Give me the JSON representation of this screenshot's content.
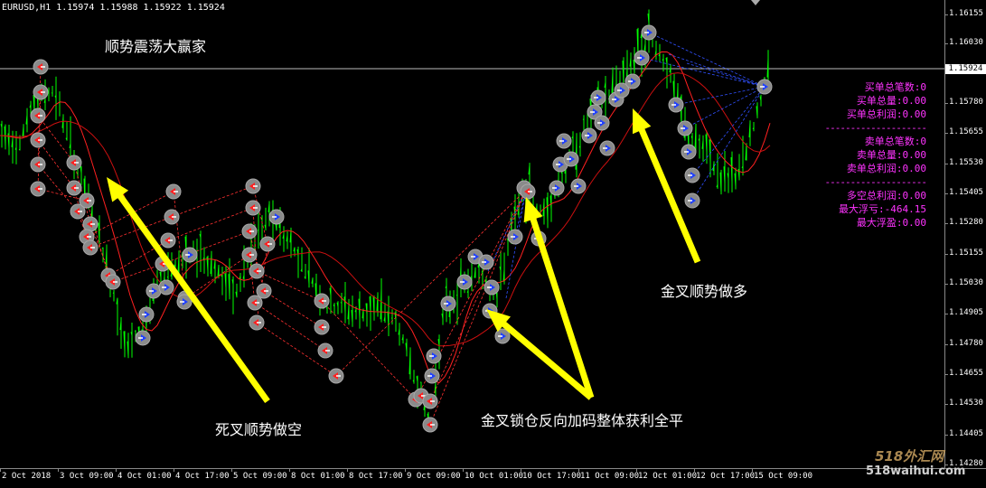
{
  "window": {
    "symbol_info": "EURUSD,H1  1.15974 1.15988 1.15922 1.15924"
  },
  "annotations": {
    "title": "顺势震荡大赢家",
    "death_cross": "死叉顺势做空",
    "golden_lock": "金叉锁仓反向加码整体获利全平",
    "golden_long": "金叉顺势做多"
  },
  "stats": {
    "buy_count": "买单总笔数:0",
    "buy_volume": "买单总量:0.00",
    "buy_profit": "买单总利润:0.00",
    "sep1": "--------------------",
    "sell_count": "卖单总笔数:0",
    "sell_volume": "卖单总量:0.00",
    "sell_profit": "卖单总利润:0.00",
    "sep2": "--------------------",
    "total_profit": "多空总利润:0.00",
    "max_float_loss": "最大浮亏:-464.15",
    "max_float_profit": "最大浮盈:0.00"
  },
  "current_price": "1.15924",
  "price_axis": [
    "1.16155",
    "1.16030",
    "1.15780",
    "1.15655",
    "1.15530",
    "1.15405",
    "1.15280",
    "1.15155",
    "1.15030",
    "1.14905",
    "1.14780",
    "1.14655",
    "1.14530",
    "1.14405",
    "1.14280"
  ],
  "time_axis": [
    "2 Oct 2018",
    "3 Oct 09:00",
    "4 Oct 01:00",
    "4 Oct 17:00",
    "5 Oct 09:00",
    "8 Oct 01:00",
    "8 Oct 17:00",
    "9 Oct 09:00",
    "10 Oct 01:00",
    "10 Oct 17:00",
    "11 Oct 09:00",
    "12 Oct 01:00",
    "12 Oct 17:00",
    "15 Oct 09:00"
  ],
  "watermark": {
    "line1": "518外汇网",
    "line2": "518waihui.com"
  },
  "colors": {
    "bull_bar": "#00ff00",
    "ma_fast": "#ff2020",
    "ma_slow": "#cc1010",
    "arrow": "#ffff00",
    "stats": "#ff33ff",
    "sell_line": "#ff3030",
    "buy_line": "#3050ff"
  },
  "chart_data": {
    "type": "line",
    "symbol": "EURUSD",
    "timeframe": "H1",
    "open": 1.15974,
    "high": 1.15988,
    "low": 1.15922,
    "close": 1.15924,
    "ylim": [
      1.1428,
      1.1622
    ]
  }
}
